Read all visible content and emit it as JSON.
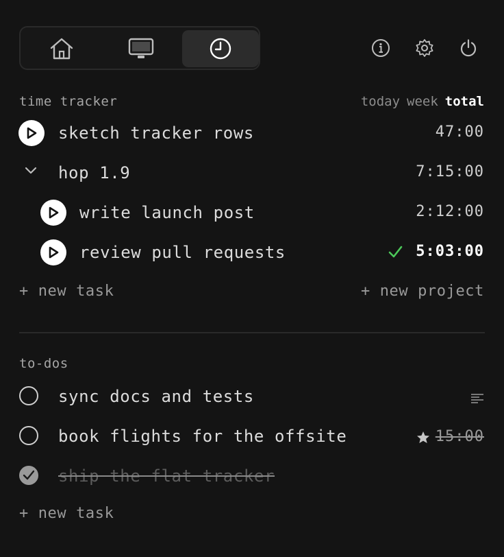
{
  "nav": {
    "tabs": [
      {
        "name": "home",
        "icon": "home-icon"
      },
      {
        "name": "screen",
        "icon": "monitor-icon"
      },
      {
        "name": "timer",
        "icon": "clock-icon",
        "active": true
      }
    ],
    "actions": [
      "info-icon",
      "settings-icon",
      "power-icon"
    ]
  },
  "tracker": {
    "label": "time tracker",
    "ranges": [
      "today",
      "week",
      "total"
    ],
    "active_range": "total",
    "rows": [
      {
        "title": "sketch tracker rows",
        "time": "47:00"
      },
      {
        "title": "hop 1.9",
        "time": "7:15:00",
        "kind": "project",
        "expanded": true
      },
      {
        "title": "write launch post",
        "time": "2:12:00"
      },
      {
        "title": "review pull requests",
        "time": "5:03:00",
        "completed": true
      }
    ],
    "new_task": "+ new task",
    "new_project": "+ new project"
  },
  "todos": {
    "label": "to-dos",
    "items": [
      {
        "title": "sync docs and tests",
        "done": false
      },
      {
        "title": "book flights for the offsite",
        "estimate": "15:00",
        "starred": true,
        "done": false
      },
      {
        "title": "ship the flat tracker",
        "done": true
      }
    ],
    "new_task": "+ new task"
  },
  "colors": {
    "background": "#141414",
    "accent_check": "#4cc85a",
    "text": "#dcdcdc",
    "muted": "#8d8d8d"
  }
}
